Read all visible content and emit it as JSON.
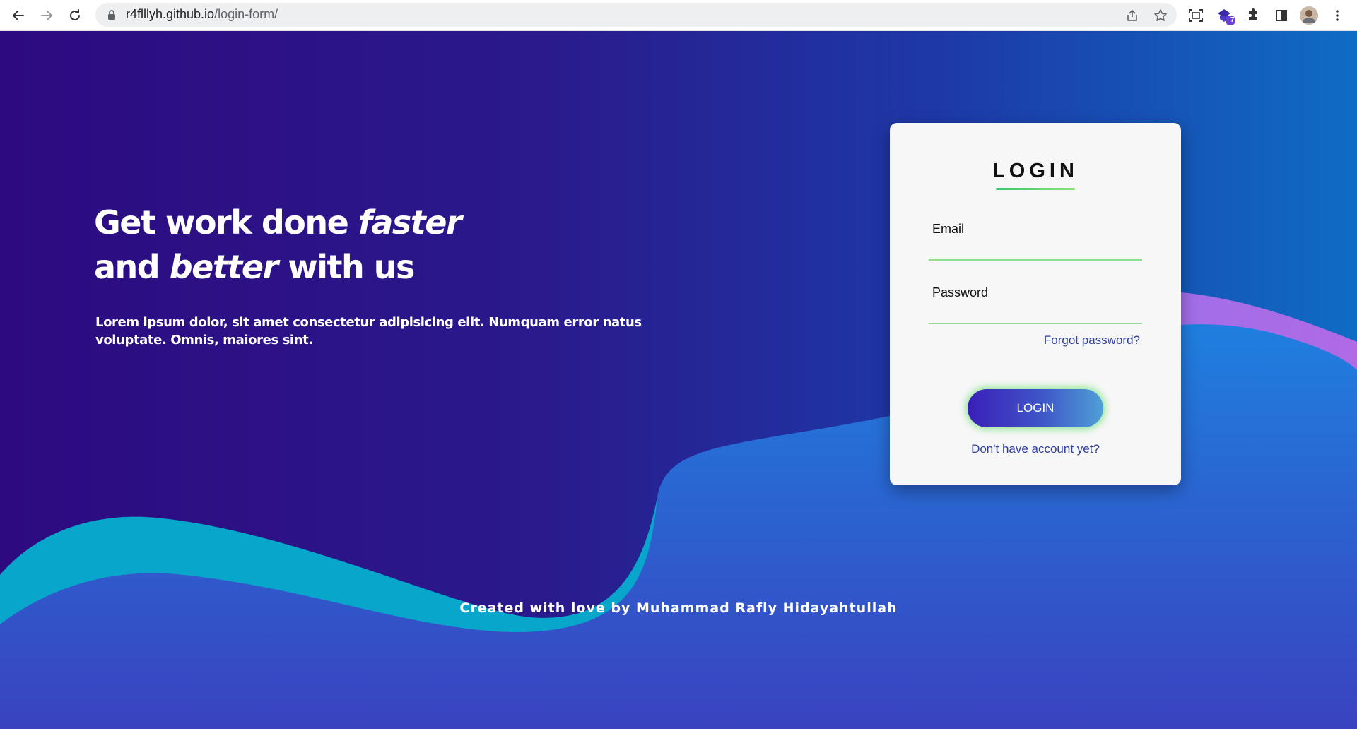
{
  "browser": {
    "url_host": "r4flllyh.github.io",
    "url_path": "/login-form/",
    "icons": [
      "back-arrow-icon",
      "forward-arrow-icon",
      "reload-icon",
      "lock-icon",
      "share-icon",
      "star-icon",
      "screen-capture-icon",
      "extension-badge-icon",
      "puzzle-icon",
      "side-panel-icon",
      "avatar",
      "kebab-menu-icon"
    ],
    "extension_badge_count": "7"
  },
  "hero": {
    "title_line1_plain": "Get work done ",
    "title_line1_emph": "faster",
    "title_line2_plain_a": "and ",
    "title_line2_emph": "better",
    "title_line2_plain_b": " with us",
    "subtitle": "Lorem ipsum dolor, sit amet consectetur adipisicing elit. Numquam error natus voluptate. Omnis, maiores sint."
  },
  "login": {
    "title": "LOGIN",
    "email_label": "Email",
    "email_value": "",
    "password_label": "Password",
    "password_value": "",
    "forgot_link": "Forgot password?",
    "submit_label": "LOGIN",
    "signup_link": "Don't have account yet?"
  },
  "footer": {
    "credit": "Created with love by Muhammad Rafly Hidayahtullah"
  },
  "colors": {
    "bg_left": "#2d0a80",
    "bg_right": "#0f6cc4",
    "wave_cyan": "#06a6cc",
    "wave_blue": "#2b7ad8",
    "wave_purple": "#a86ae6",
    "input_underline": "#8fde8a",
    "link": "#2f3fa0",
    "button_glow": "#6fe078"
  }
}
